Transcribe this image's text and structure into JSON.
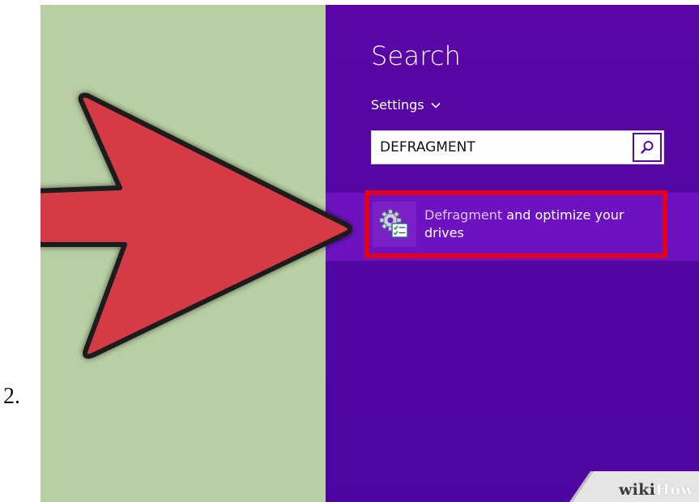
{
  "step": {
    "number": "2."
  },
  "search_panel": {
    "title": "Search",
    "scope_label": "Settings",
    "scope_chevron": "chevron-down",
    "query": "DEFRAGMENT",
    "search_icon": "magnifier-icon"
  },
  "results": [
    {
      "match": "Defragment",
      "rest": " and optimize your drives",
      "icon": "defrag-settings-icon"
    }
  ],
  "watermark": {
    "wiki": "wiki",
    "how": "How"
  },
  "colors": {
    "green_background": "#b8cfa3",
    "purple_background": "#5407a3",
    "highlight_band": "#6d12c0",
    "highlight_outline": "#e3001b",
    "arrow_fill": "#d43a44"
  }
}
